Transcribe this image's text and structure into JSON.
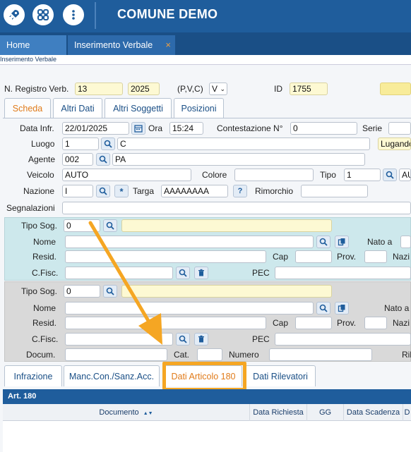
{
  "app": {
    "title": "COMUNE DEMO",
    "icons": [
      "rocket-icon",
      "grid-icon",
      "menu-dots-icon"
    ]
  },
  "window_tabs": [
    {
      "label": "Home"
    },
    {
      "label": "Inserimento Verbale",
      "close": "×"
    }
  ],
  "breadcrumb": "Inserimento Verbale",
  "header": {
    "reg_label": "N. Registro Verb.",
    "reg_value": "13",
    "year_value": "2025",
    "pvc_label": "(P,V,C)",
    "pvc_value": "V",
    "id_label": "ID",
    "id_value": "1755"
  },
  "inner_tabs": [
    "Scheda",
    "Altri Dati",
    "Altri Soggetti",
    "Posizioni"
  ],
  "scheda": {
    "data_infr_label": "Data Infr.",
    "data_infr_value": "22/01/2025",
    "ora_label": "Ora",
    "ora_value": "15:24",
    "contest_label": "Contestazione N°",
    "contest_value": "0",
    "serie_label": "Serie",
    "luogo_label": "Luogo",
    "luogo_code": "1",
    "luogo_desc": "C",
    "luogo_city": "Lugando",
    "agente_label": "Agente",
    "agente_code": "002",
    "agente_desc": "PA",
    "veicolo_label": "Veicolo",
    "veicolo_value": "AUTO",
    "colore_label": "Colore",
    "tipo_label": "Tipo",
    "tipo_code": "1",
    "tipo_desc": "AU",
    "nazione_label": "Nazione",
    "nazione_value": "I",
    "star": "*",
    "targa_label": "Targa",
    "targa_value": "AAAAAAAA",
    "targa_help": "?",
    "rimorchio_label": "Rimorchio",
    "segnalazioni_label": "Segnalazioni"
  },
  "soggetto1": {
    "tipo_label": "Tipo Sog.",
    "tipo_value": "0",
    "nome_label": "Nome",
    "nato_label": "Nato a",
    "resid_label": "Resid.",
    "cap_label": "Cap",
    "prov_label": "Prov.",
    "nazi_label": "Nazi",
    "cfisc_label": "C.Fisc.",
    "pec_label": "PEC"
  },
  "soggetto2": {
    "tipo_label": "Tipo Sog.",
    "tipo_value": "0",
    "nome_label": "Nome",
    "nato_label": "Nato a",
    "resid_label": "Resid.",
    "cap_label": "Cap",
    "prov_label": "Prov.",
    "nazi_label": "Nazi",
    "cfisc_label": "C.Fisc.",
    "pec_label": "PEC",
    "docum_label": "Docum.",
    "cat_label": "Cat.",
    "numero_label": "Numero",
    "ril_label": "Ril"
  },
  "bottom_tabs": [
    "Infrazione",
    "Manc.Con./Sanz.Acc.",
    "Dati Articolo 180",
    "Dati Rilevatori"
  ],
  "art180": {
    "title": "Art. 180",
    "columns": [
      "Documento",
      "Data Richiesta",
      "GG",
      "Data Scadenza",
      "D"
    ],
    "sort_icon": "▲▼"
  },
  "colors": {
    "topbar": "#1f5d9c",
    "accent": "#e07b1a",
    "highlight": "#f5a623",
    "soggetto1_bg": "#cde8ec",
    "soggetto2_bg": "#d9d9d9"
  }
}
